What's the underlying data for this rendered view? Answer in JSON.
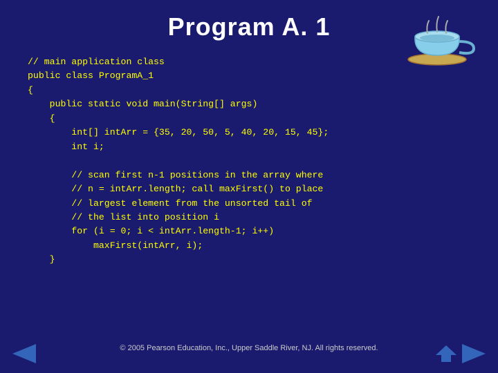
{
  "title": "Program A. 1",
  "code": [
    "// main application class",
    "public class ProgramA_1",
    "{",
    "    public static void main(String[] args)",
    "    {",
    "        int[] intArr = {35, 20, 50, 5, 40, 20, 15, 45};",
    "        int i;",
    "",
    "        // scan first n-1 positions in the array where",
    "        // n = intArr.length; call maxFirst() to place",
    "        // largest element from the unsorted tail of",
    "        // the list into position i",
    "        for (i = 0; i < intArr.length-1; i++)",
    "            maxFirst(intArr, i);",
    "    }"
  ],
  "footer": "© 2005 Pearson Education, Inc.,  Upper Saddle River, NJ.  All rights reserved.",
  "nav": {
    "prev_label": "◀",
    "home_label": "⌂",
    "next_label": "▶"
  }
}
